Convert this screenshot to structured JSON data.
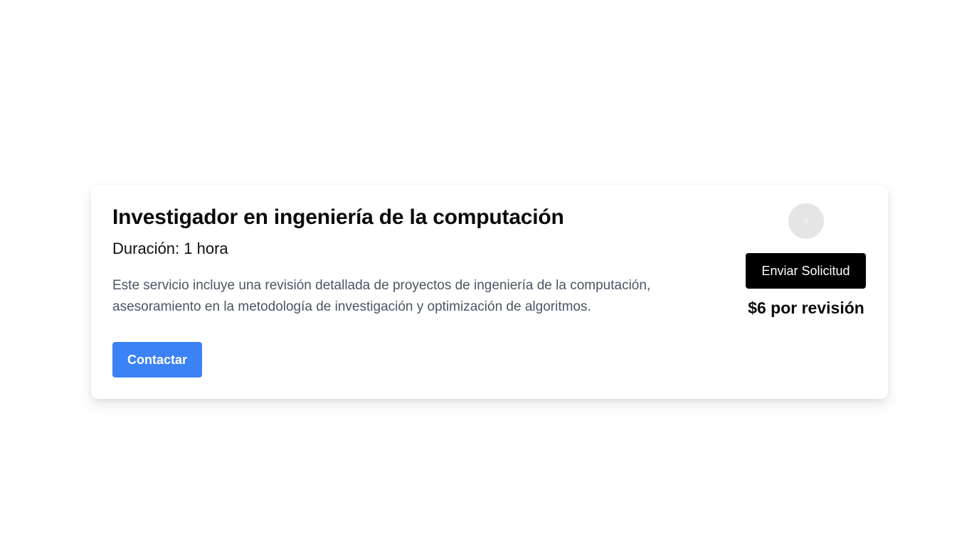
{
  "service": {
    "title": "Investigador en ingeniería de la computación",
    "duration": "Duración: 1 hora",
    "description": "Este servicio incluye una revisión detallada de proyectos de ingeniería de la computación, asesoramiento en la metodología de investigación y optimización de algoritmos.",
    "contact_label": "Contactar",
    "request_label": "Enviar Solicitud",
    "price": "$6 por revisión",
    "avatar_icon": "avatar-placeholder-icon"
  },
  "colors": {
    "contact_button": "#3b82f6",
    "request_button": "#000000",
    "description_text": "#4b5563",
    "avatar_bg": "#e5e5e5"
  }
}
